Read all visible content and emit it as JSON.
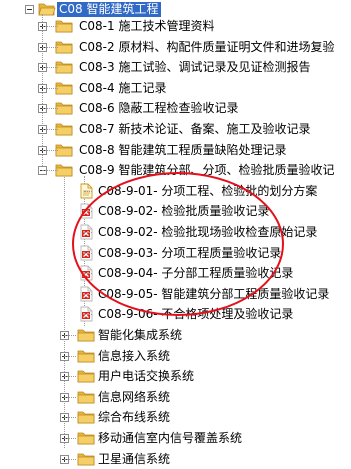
{
  "tree": {
    "root": {
      "code": "C08",
      "name": "智能建筑工程"
    },
    "level1": [
      {
        "code": "C08-1",
        "name": "施工技术管理资料",
        "state": "collapsed"
      },
      {
        "code": "C08-2",
        "name": "原材料、构配件质量证明文件和进场复验",
        "state": "collapsed"
      },
      {
        "code": "C08-3",
        "name": "施工试验、调试记录及见证检测报告",
        "state": "collapsed"
      },
      {
        "code": "C08-4",
        "name": "施工记录",
        "state": "collapsed"
      },
      {
        "code": "C08-6",
        "name": "隐蔽工程检查验收记录",
        "state": "collapsed"
      },
      {
        "code": "C08-7",
        "name": "新技术论证、备案、施工及验收记录",
        "state": "collapsed"
      },
      {
        "code": "C08-8",
        "name": "智能建筑工程质量缺陷处理记录",
        "state": "collapsed"
      },
      {
        "code": "C08-9",
        "name": "智能建筑分部、分项、检验批质量验收记",
        "state": "expanded"
      }
    ],
    "c08_9_children": [
      {
        "code": "C08-9-01-",
        "name": "分项工程、检验批的划分方案",
        "icon": "document-icon"
      },
      {
        "code": "C08-9-02-",
        "name": "检验批质量验收记录",
        "icon": "pdf-icon"
      },
      {
        "code": "C08-9-02-",
        "name": "检验批现场验收检查原始记录",
        "icon": "pdf-icon"
      },
      {
        "code": "C08-9-03-",
        "name": "分项工程质量验收记录",
        "icon": "pdf-icon"
      },
      {
        "code": "C08-9-04-",
        "name": "子分部工程质量验收记录",
        "icon": "pdf-icon"
      },
      {
        "code": "C08-9-05-",
        "name": "智能建筑分部工程质量验收记录",
        "icon": "pdf-icon"
      },
      {
        "code": "C08-9-06-",
        "name": "不合格项处理及验收记录",
        "icon": "pdf-icon"
      }
    ],
    "subsystems": [
      "智能化集成系统",
      "信息接入系统",
      "用户电话交换系统",
      "信息网络系统",
      "综合布线系统",
      "移动通信室内信号覆盖系统",
      "卫星通信系统"
    ]
  },
  "colors": {
    "folder": "#f2c14e",
    "selection": "#3169c6",
    "annotation": "#e4101b",
    "pdf": "#d9261c"
  }
}
